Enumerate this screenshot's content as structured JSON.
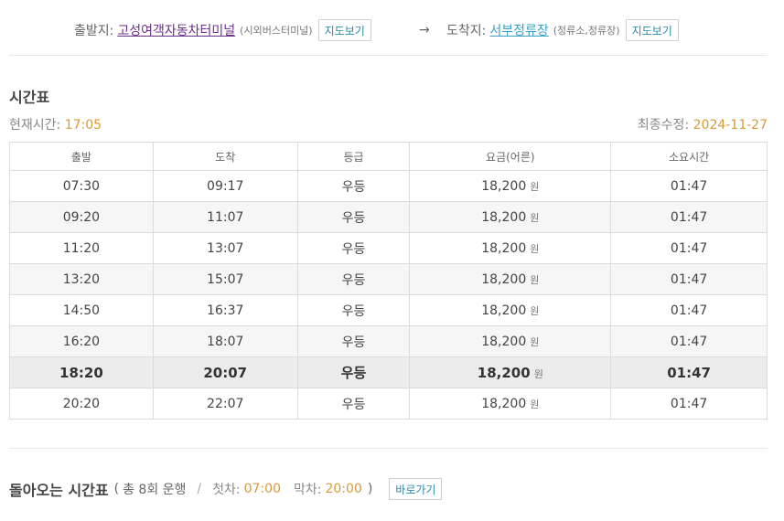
{
  "route": {
    "departure_label": "출발지:",
    "departure_name": "고성여객자동차터미널",
    "departure_sub": "(시외버스터미널)",
    "map_button": "지도보기",
    "arrow": "→",
    "arrival_label": "도착지:",
    "arrival_name": "서부정류장",
    "arrival_sub": "(정류소,정류장)"
  },
  "timetable": {
    "title": "시간표",
    "now_label": "현재시간:",
    "now_value": "17:05",
    "updated_label": "최종수정:",
    "updated_value": "2024-11-27",
    "currency_unit": "원",
    "columns": [
      "출발",
      "도착",
      "등급",
      "요금(어른)",
      "소요시간"
    ],
    "rows": [
      {
        "depart": "07:30",
        "arrive": "09:17",
        "grade": "우등",
        "fare": "18,200",
        "duration": "01:47"
      },
      {
        "depart": "09:20",
        "arrive": "11:07",
        "grade": "우등",
        "fare": "18,200",
        "duration": "01:47"
      },
      {
        "depart": "11:20",
        "arrive": "13:07",
        "grade": "우등",
        "fare": "18,200",
        "duration": "01:47"
      },
      {
        "depart": "13:20",
        "arrive": "15:07",
        "grade": "우등",
        "fare": "18,200",
        "duration": "01:47"
      },
      {
        "depart": "14:50",
        "arrive": "16:37",
        "grade": "우등",
        "fare": "18,200",
        "duration": "01:47"
      },
      {
        "depart": "16:20",
        "arrive": "18:07",
        "grade": "우등",
        "fare": "18,200",
        "duration": "01:47"
      },
      {
        "depart": "18:20",
        "arrive": "20:07",
        "grade": "우등",
        "fare": "18,200",
        "duration": "01:47"
      },
      {
        "depart": "20:20",
        "arrive": "22:07",
        "grade": "우등",
        "fare": "18,200",
        "duration": "01:47"
      }
    ],
    "highlight_row_index": 6
  },
  "return_section": {
    "title": "돌아오는 시간표",
    "paren_open": "(",
    "count_text": "총 8회 운행",
    "separator": "/",
    "first_label": "첫차:",
    "first_value": "07:00",
    "last_label": "막차:",
    "last_value": "20:00",
    "paren_close": ")",
    "go_button": "바로가기"
  },
  "colors": {
    "accent_orange": "#d89a3a",
    "link_blue": "#3aa0c8",
    "link_visited": "#6a2f8c",
    "button_text": "#2a8aa8"
  }
}
